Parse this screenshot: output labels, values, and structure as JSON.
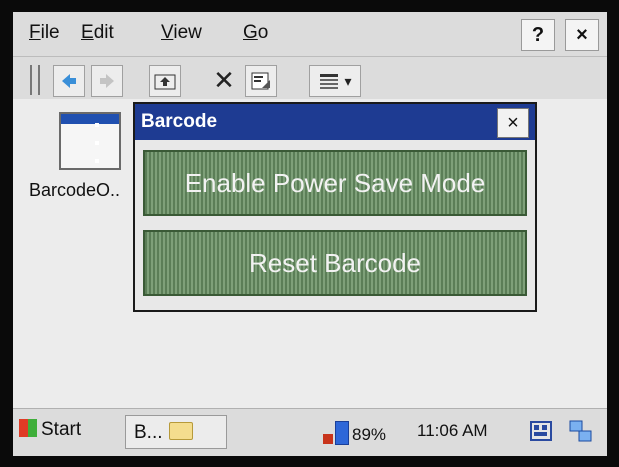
{
  "menubar": {
    "items": [
      {
        "label": "File",
        "accel": "F",
        "rest": "ile"
      },
      {
        "label": "Edit",
        "accel": "E",
        "rest": "dit"
      },
      {
        "label": "View",
        "accel": "V",
        "rest": "iew"
      },
      {
        "label": "Go",
        "accel": "G",
        "rest": "o"
      }
    ],
    "help_label": "?",
    "close_label": "×"
  },
  "toolbar": {
    "back_icon": "back-arrow-icon",
    "forward_icon": "forward-arrow-icon",
    "up_icon": "folder-up-icon",
    "delete_label": "✕",
    "properties_icon": "properties-icon",
    "views_icon": "views-icon",
    "views_dropdown": "▾"
  },
  "files": [
    {
      "label": "BarcodeO..",
      "icon": "application-window-icon"
    }
  ],
  "dialog": {
    "title": "Barcode",
    "close_label": "×",
    "buttons": [
      {
        "label": "Enable Power Save Mode"
      },
      {
        "label": "Reset Barcode"
      }
    ],
    "colors": {
      "title_bar": "#1e3b92",
      "button": "#6d8f68"
    }
  },
  "taskbar": {
    "start_label": "Start",
    "task_label": "B...",
    "battery_percent": "89%",
    "time": "11:06 AM"
  }
}
